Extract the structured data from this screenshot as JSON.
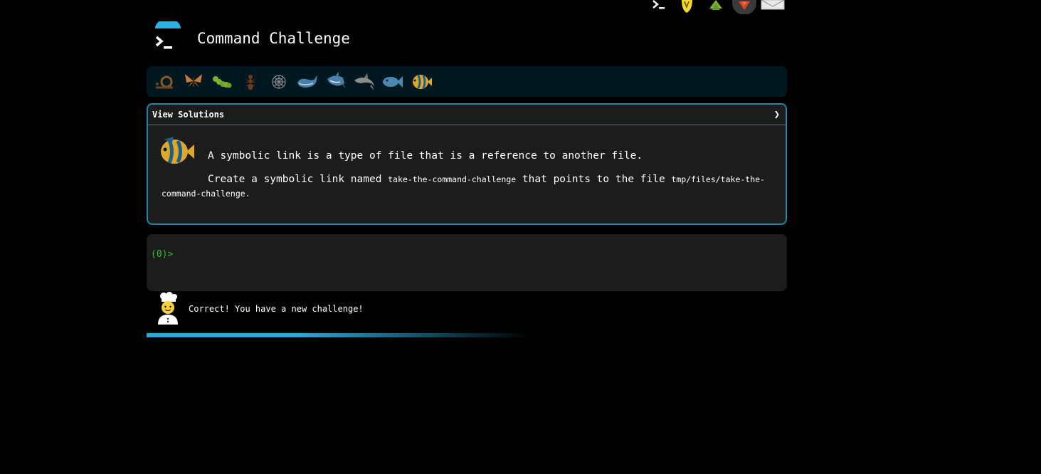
{
  "top_nav": {
    "icons": [
      "terminal-icon",
      "lightbulb-icon",
      "tree-icon",
      "gitlab-icon",
      "mail-icon"
    ]
  },
  "header": {
    "title": "Command Challenge",
    "logo_icon": "terminal-prompt-icon",
    "accent_color": "#2ab2e6"
  },
  "levels": [
    {
      "name": "snail-icon",
      "color": "#8a5a2b"
    },
    {
      "name": "butterfly-icon",
      "color": "#c07a3a"
    },
    {
      "name": "caterpillar-icon",
      "color": "#7ab42f"
    },
    {
      "name": "ant-icon",
      "color": "#6e3a1e"
    },
    {
      "name": "spider-web-icon",
      "color": "#888888"
    },
    {
      "name": "whale-icon",
      "color": "#4a7fa8"
    },
    {
      "name": "shark-icon",
      "color": "#4a7fa8"
    },
    {
      "name": "dolphin-icon",
      "color": "#8c8c8c"
    },
    {
      "name": "fish-icon",
      "color": "#4a88b4"
    },
    {
      "name": "tropical-fish-icon",
      "color": "#e0a82a"
    }
  ],
  "challenge": {
    "solutions_label": "View Solutions",
    "text1": "A symbolic link is a type of file that is a reference to another file.",
    "text2_prefix": "Create a symbolic link named ",
    "link_name": "take-the-command-challenge",
    "text2_middle": " that points to the file ",
    "target_path": "tmp/files/take-the-command-challenge",
    "text2_suffix": ".",
    "border_color": "#1f86a8"
  },
  "terminal": {
    "prompt": "(0)>"
  },
  "feedback": {
    "message": "Correct! You have a new challenge!"
  },
  "progress": {
    "fraction": 0.35
  }
}
